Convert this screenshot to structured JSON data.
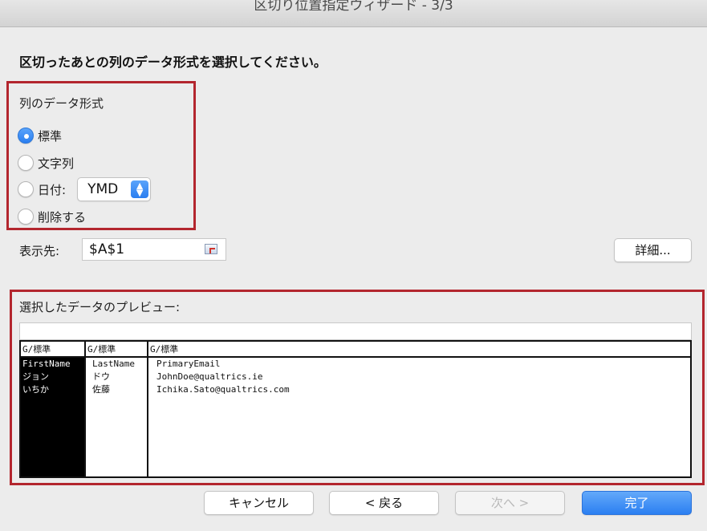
{
  "window": {
    "title": "区切り位置指定ウィザード - 3/3"
  },
  "instruction": "区切ったあとの列のデータ形式を選択してください。",
  "column_format": {
    "label": "列のデータ形式",
    "options": [
      {
        "label": "標準",
        "selected": true
      },
      {
        "label": "文字列",
        "selected": false
      },
      {
        "label": "日付:",
        "selected": false
      },
      {
        "label": "削除する",
        "selected": false
      }
    ],
    "date_format": {
      "value": "YMD"
    }
  },
  "destination": {
    "label": "表示先:",
    "value": "$A$1"
  },
  "advanced_button": "詳細...",
  "preview": {
    "label": "選択したデータのプレビュー:",
    "columns": [
      {
        "header": "G/標準",
        "cells": [
          "FirstName",
          "ジョン",
          "いちか"
        ]
      },
      {
        "header": "G/標準",
        "cells": [
          "LastName",
          "ドウ",
          "佐藤"
        ]
      },
      {
        "header": "G/標準",
        "cells": [
          "PrimaryEmail",
          "JohnDoe@qualtrics.ie",
          "Ichika.Sato@qualtrics.com"
        ]
      }
    ]
  },
  "buttons": {
    "cancel": "キャンセル",
    "back": "< 戻る",
    "next": "次へ >",
    "finish": "完了"
  },
  "colors": {
    "accent": "#2b7ff1",
    "highlight_border": "#b3262e"
  }
}
